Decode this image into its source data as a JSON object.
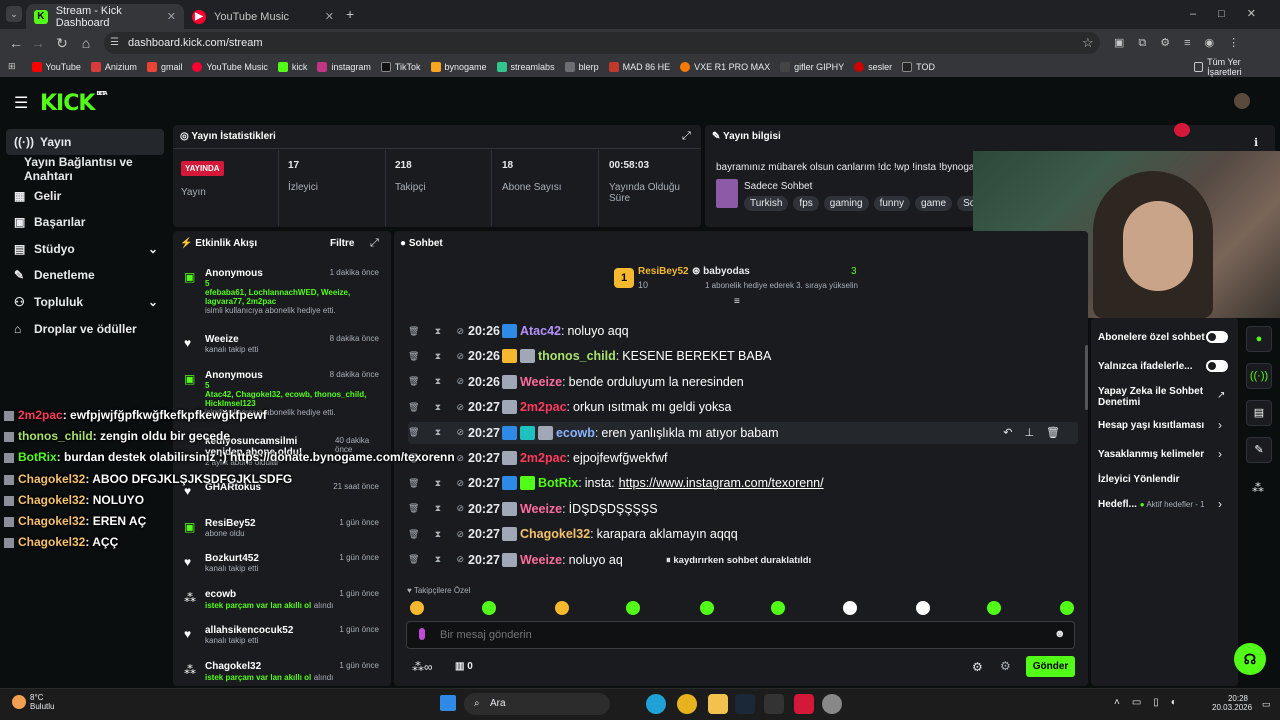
{
  "browser": {
    "tabs": [
      {
        "title": "Stream - Kick Dashboard",
        "active": true
      },
      {
        "title": "YouTube Music",
        "active": false
      }
    ],
    "url": "dashboard.kick.com/stream",
    "bookmarks": [
      "YouTube",
      "Anizium",
      "gmail",
      "YouTube Music",
      "kick",
      "instagram",
      "TikTok",
      "bynogame",
      "streamlabs",
      "blerp",
      "MAD 86 HE",
      "VXE R1 PRO MAX",
      "gifler GIPHY",
      "sesler",
      "TOD"
    ],
    "all_bookmarks": "Tüm Yer İşaretleri"
  },
  "brand": {
    "logo": "KICK",
    "beta": "BETA",
    "accent": "#53fc18"
  },
  "sidebar": {
    "items": [
      {
        "label": "Yayın",
        "icon": "broadcast-icon"
      },
      {
        "label": "Yayın Bağlantısı ve Anahtarı"
      },
      {
        "label": "Gelir",
        "icon": "revenue-icon"
      },
      {
        "label": "Başarılar",
        "icon": "trophy-icon"
      },
      {
        "label": "Stüdyo",
        "icon": "studio-icon"
      },
      {
        "label": "Denetleme",
        "icon": "wrench-icon"
      },
      {
        "label": "Topluluk",
        "icon": "community-icon"
      },
      {
        "label": "Droplar ve ödüller",
        "icon": "gift-icon"
      }
    ]
  },
  "stats": {
    "title": "Yayın İstatistikleri",
    "live_badge": "YAYINDA",
    "live_label": "Yayın",
    "items": [
      {
        "value": "17",
        "label": "İzleyici"
      },
      {
        "value": "218",
        "label": "Takipçi"
      },
      {
        "value": "18",
        "label": "Abone Sayısı"
      },
      {
        "value": "00:58:03",
        "label": "Yayında Olduğu Süre"
      }
    ]
  },
  "info": {
    "title": "Yayın bilgisi",
    "stream_title": "bayramınız mübarek olsun canlarım !dc !wp !insta !bynogame",
    "category": "Sadece Sohbet",
    "tags": [
      "Turkish",
      "fps",
      "gaming",
      "funny",
      "game",
      "Soh"
    ]
  },
  "feed": {
    "title": "Etkinlik Akışı",
    "filter": "Filtre",
    "events": [
      {
        "name": "Anonymous",
        "time": "1 dakika önce",
        "count": "5",
        "users": "efebaba61, LochlannachWED, Weeize, lagvara77, 2m2pac",
        "sub": "isimli kullanıcıya abonelik hediye etti."
      },
      {
        "name": "Weeize",
        "time": "8 dakika önce",
        "sub": "kanalı takip etti"
      },
      {
        "name": "Anonymous",
        "time": "8 dakika önce",
        "count": "5",
        "users": "Atac42, Chagokel32, ecowb, thonos_child, HickImsel123",
        "sub": "isimli kullanıcıya abonelik hediye etti."
      },
      {
        "name": "kediyosuncamsilmi yeniden abone oldu!",
        "time": "40 dakika önce",
        "sub": "2 aylık abone oldular"
      },
      {
        "name": "GHARtokus",
        "time": "21 saat önce",
        "sub": ""
      },
      {
        "name": "ResiBey52",
        "time": "1 gün önce",
        "sub": "abone oldu"
      },
      {
        "name": "Bozkurt452",
        "time": "1 gün önce",
        "sub": "kanalı takip etti"
      },
      {
        "name": "ecowb",
        "time": "1 gün önce",
        "gr": "istek parçam var lan akıllı ol",
        "sub": "alındı"
      },
      {
        "name": "allahsikencocuk52",
        "time": "1 gün önce",
        "sub": "kanalı takip etti"
      },
      {
        "name": "Chagokel32",
        "time": "1 gün önce",
        "gr": "istek parçam var lan akıllı ol",
        "sub": "alındı"
      }
    ]
  },
  "chat": {
    "title": "Sohbet",
    "leader1": {
      "rank": "1",
      "name": "ResiBey52",
      "count": "10"
    },
    "leader2": {
      "name": "babyodas",
      "count": "3",
      "note": "1 abonelik hediye ederek 3. sıraya yükselin"
    },
    "messages": [
      {
        "time": "20:26",
        "user": "Atac42",
        "color": "#b592ff",
        "text": "noluyo aqq"
      },
      {
        "time": "20:26",
        "user": "thonos_child",
        "color": "#a8e06a",
        "text": "KESENE BEREKET BABA"
      },
      {
        "time": "20:26",
        "user": "Weeize",
        "color": "#ff6b9d",
        "text": "bende orduluyum la neresinden"
      },
      {
        "time": "20:27",
        "user": "2m2pac",
        "color": "#ff3b5c",
        "text": "orkun ısıtmak mı geldi yoksa"
      },
      {
        "time": "20:27",
        "user": "ecowb",
        "color": "#8ab4ff",
        "text": "eren yanlışlıkla mı atıyor babam"
      },
      {
        "time": "20:27",
        "user": "2m2pac",
        "color": "#ff3b5c",
        "text": "ejpojfewfğwekfwf"
      },
      {
        "time": "20:27",
        "user": "BotRix",
        "color": "#53fc18",
        "text": "insta:",
        "link": "https://www.instagram.com/texorenn/"
      },
      {
        "time": "20:27",
        "user": "Weeize",
        "color": "#ff6b9d",
        "text": "İDŞDŞDŞŞŞŞS"
      },
      {
        "time": "20:27",
        "user": "Chagokel32",
        "color": "#f5c26b",
        "text": "karapara aklamayın aqqq"
      },
      {
        "time": "20:27",
        "user": "Weeize",
        "color": "#ff6b9d",
        "text": "noluyo aq"
      }
    ],
    "paused": "kaydırırken sohbet duraklatıldı",
    "followers_only": "Takipçilere Özel",
    "placeholder": "Bir mesaj gönderin",
    "send": "Gönder",
    "points": "0"
  },
  "settings": [
    {
      "label": "Abonelere özel sohbet"
    },
    {
      "label": "Yalnızca ifadelerle..."
    },
    {
      "label": "Yapay Zeka ile Sohbet Denetimi"
    },
    {
      "label": "Hesap yaşı kısıtlaması"
    },
    {
      "label": "Yasaklanmış kelimeler"
    },
    {
      "label": "İzleyici Yönlendir"
    },
    {
      "label": "Hedefl...",
      "extra": "Aktif hedefler - 1"
    }
  ],
  "overlay": [
    {
      "user": "2m2pac",
      "color": "#ff3b5c",
      "text": ": ewfpjwjfğpfkwğfkefkpfkewğkfpewf"
    },
    {
      "user": "thonos_child",
      "color": "#a8e06a",
      "text": ": zengin oldu bir gecede"
    },
    {
      "user": "BotRix",
      "color": "#53fc18",
      "text": ": burdan destek olabilirsiniz :) https://donate.bynogame.com/texorenn"
    },
    {
      "user": "Chagokel32",
      "color": "#f5c26b",
      "text": ": ABOO DFGJKLŞJKSDFGJKLSDFG"
    },
    {
      "user": "Chagokel32",
      "color": "#f5c26b",
      "text": ": NOLUYO"
    },
    {
      "user": "Chagokel32",
      "color": "#f5c26b",
      "text": ": EREN AÇ"
    },
    {
      "user": "Chagokel32",
      "color": "#f5c26b",
      "text": ": AÇÇ"
    }
  ],
  "taskbar": {
    "temp": "8°C",
    "weather": "Bulutlu",
    "search": "Ara",
    "time": "20:28",
    "date": "20.03.2026"
  }
}
